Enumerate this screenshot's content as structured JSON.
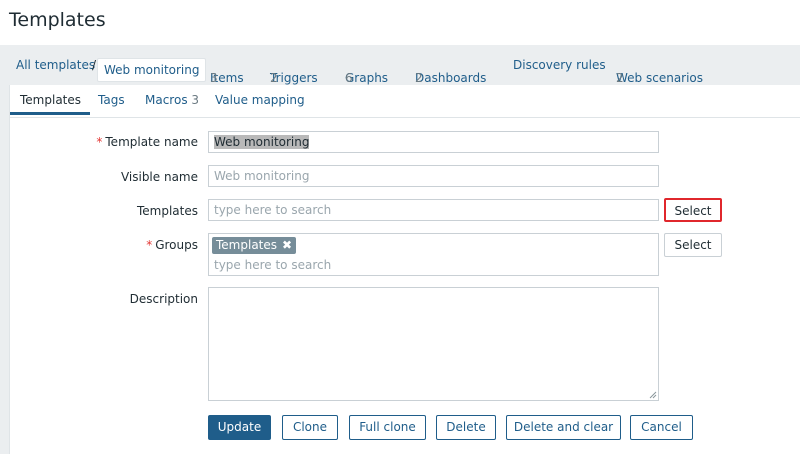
{
  "page": {
    "title": "Templates"
  },
  "breadcrumb": {
    "all_templates": "All templates",
    "separator": "/",
    "current": "Web monitoring"
  },
  "nav": {
    "items": {
      "label": "Items",
      "count": "3"
    },
    "triggers": {
      "label": "Triggers",
      "count": "2"
    },
    "graphs": {
      "label": "Graphs",
      "count": "6"
    },
    "dashboards": {
      "label": "Dashboards",
      "count": "2"
    },
    "discovery": {
      "label": "Discovery rules"
    },
    "web": {
      "label": "Web scenarios",
      "count": "2"
    }
  },
  "tabs": {
    "templates": "Templates",
    "tags": "Tags",
    "macros": {
      "label": "Macros",
      "count": "3"
    },
    "value_mapping": "Value mapping"
  },
  "form": {
    "template_name": {
      "label": "Template name",
      "required_mark": "*",
      "value": "Web monitoring"
    },
    "visible_name": {
      "label": "Visible name",
      "placeholder": "Web monitoring"
    },
    "templates": {
      "label": "Templates",
      "placeholder": "type here to search",
      "select_label": "Select"
    },
    "groups": {
      "label": "Groups",
      "required_mark": "*",
      "chip": "Templates",
      "chip_remove": "✖",
      "placeholder": "type here to search",
      "select_label": "Select"
    },
    "description": {
      "label": "Description"
    }
  },
  "buttons": {
    "update": "Update",
    "clone": "Clone",
    "full_clone": "Full clone",
    "delete": "Delete",
    "delete_and_clear": "Delete and clear",
    "cancel": "Cancel"
  },
  "colors": {
    "link": "#1f5d8a",
    "required": "#e33734",
    "highlight_border": "#e0272c",
    "chip_bg": "#768d99"
  }
}
